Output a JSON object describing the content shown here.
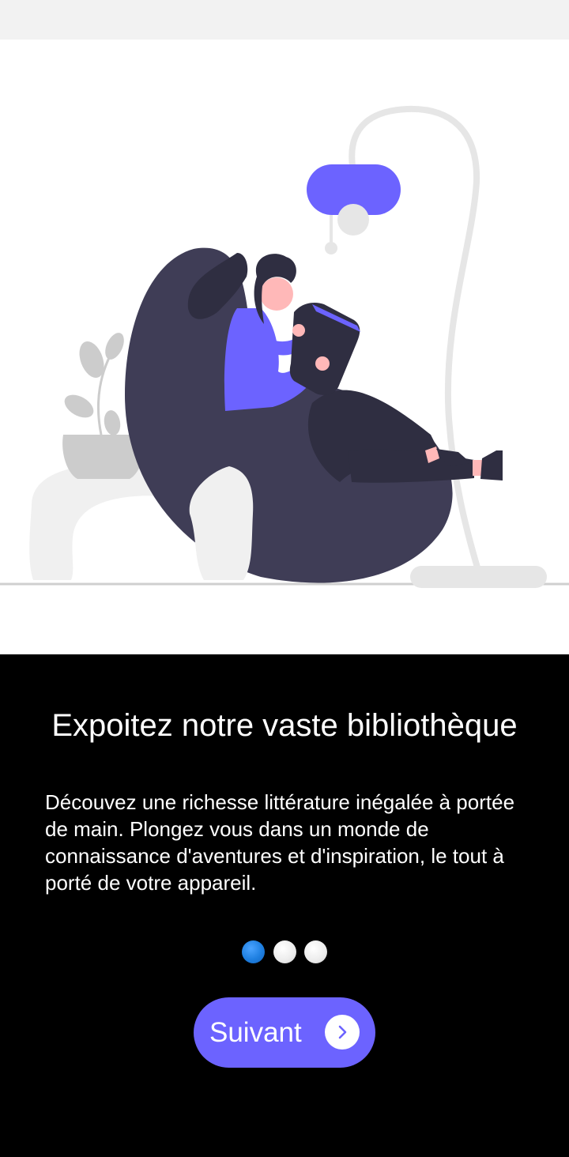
{
  "onboarding": {
    "title": "Expoitez notre vaste bibliothèque",
    "description": "Découvez une richesse littérature inégalée à portée de main. Plongez vous dans un monde de connaissance d'aventures et d'inspiration, le tout à porté de votre appareil.",
    "current_page": 1,
    "total_pages": 3
  },
  "next_button": {
    "label": "Suivant",
    "icon": "chevron-right-icon"
  },
  "colors": {
    "accent": "#6c63ff",
    "active_dot": "#1e7fe0",
    "dark_figure": "#3f3d56",
    "background_dark": "#000000"
  }
}
